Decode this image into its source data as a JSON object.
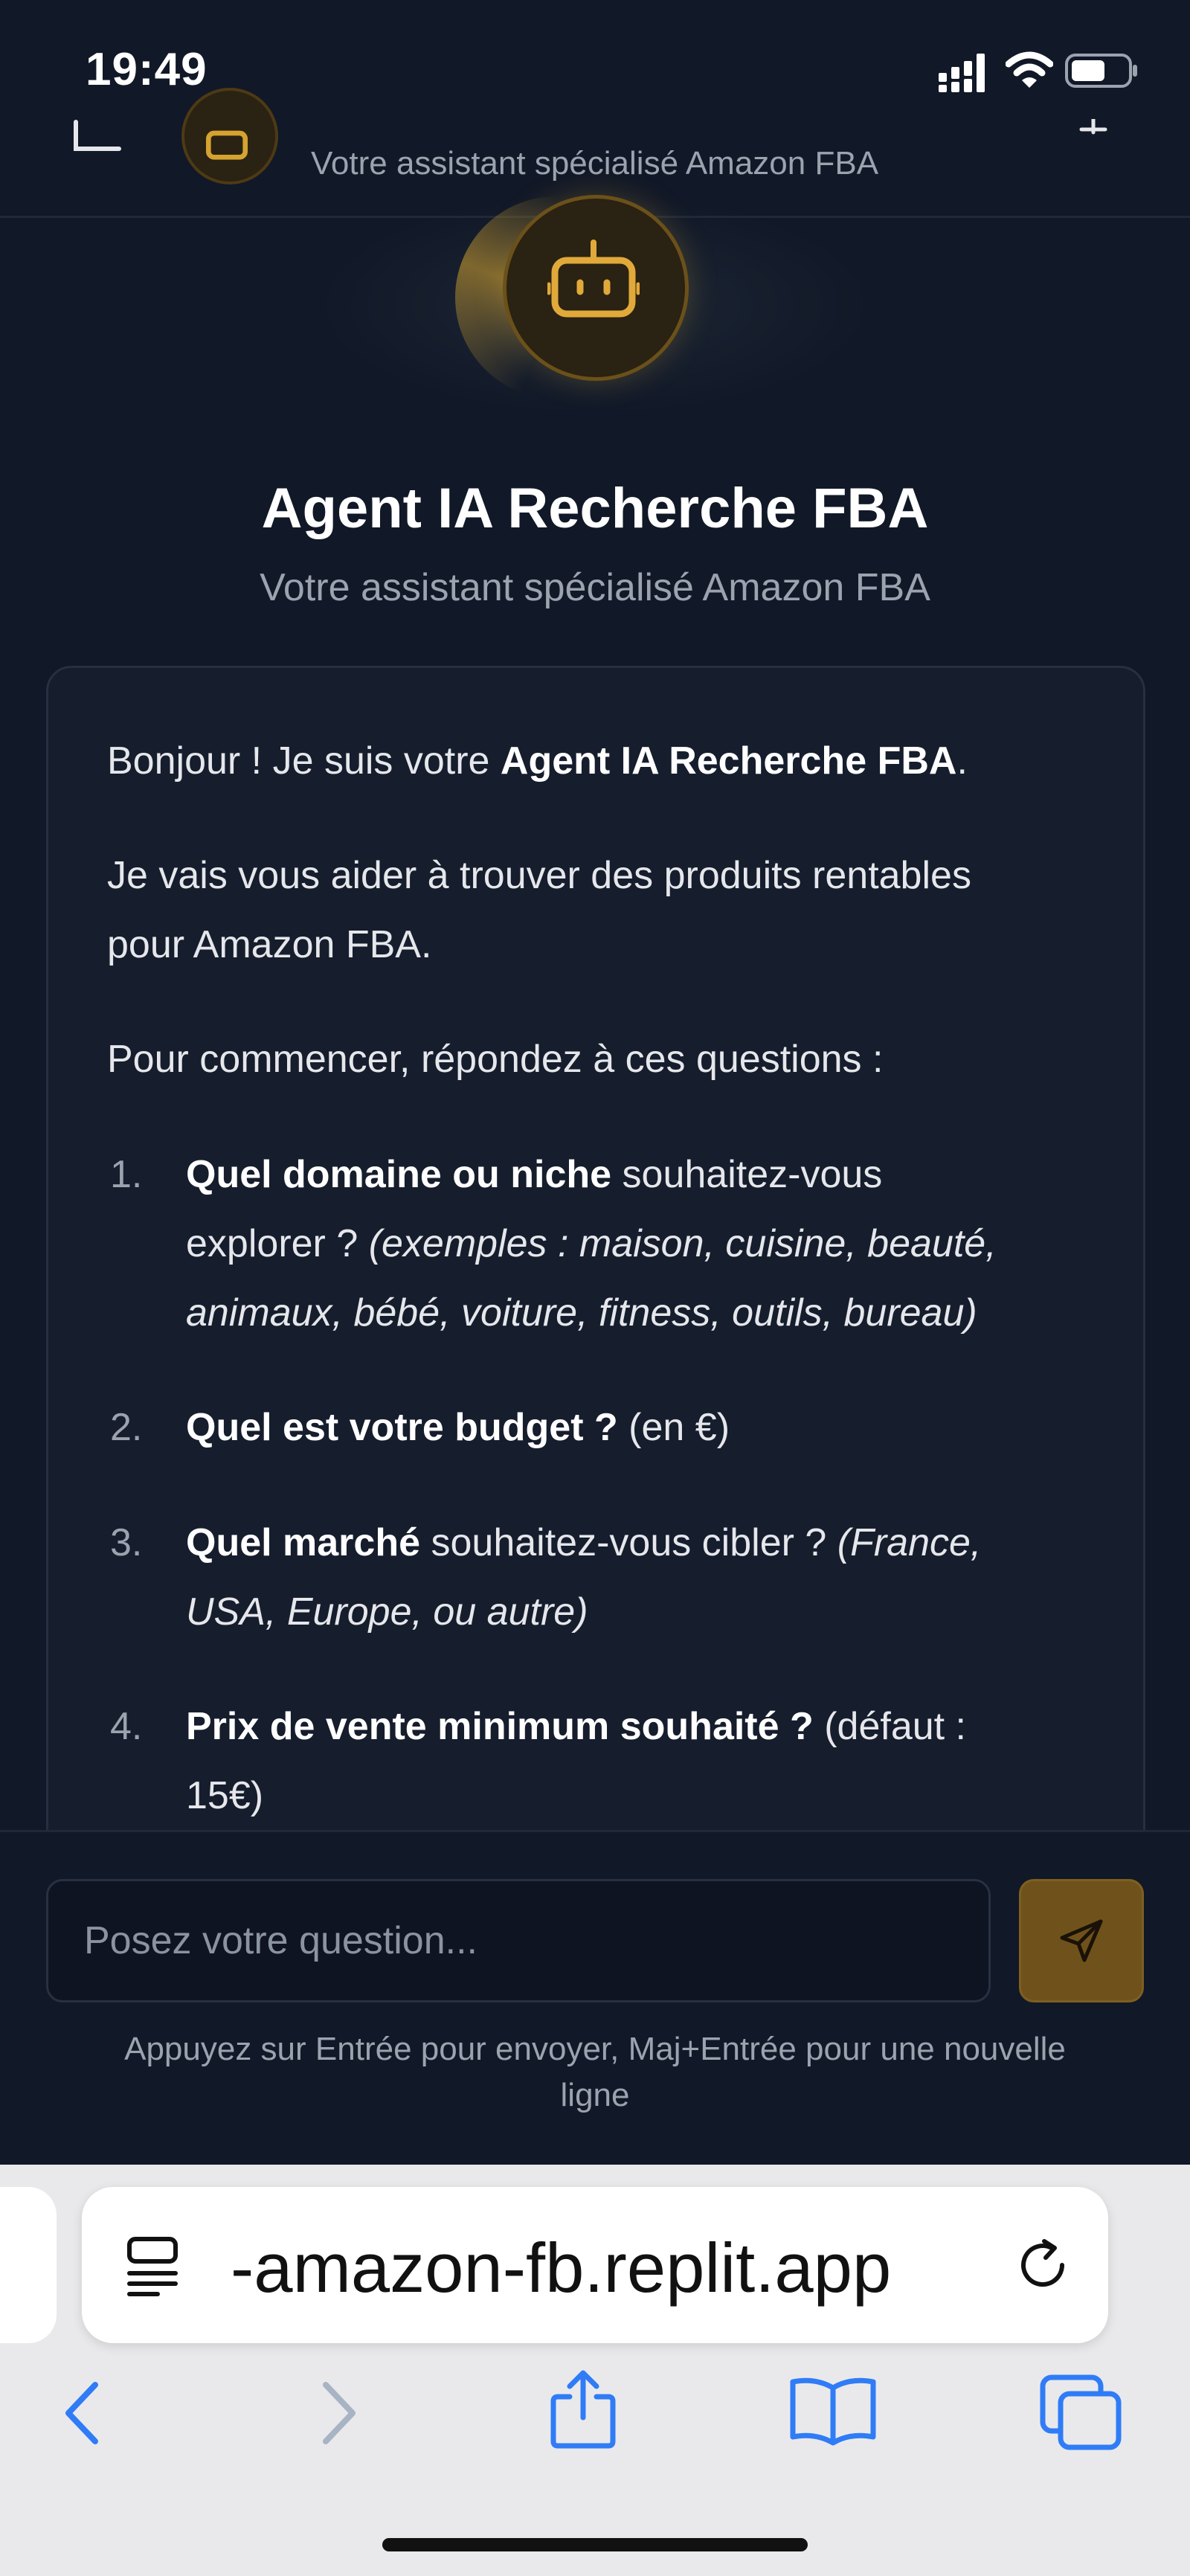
{
  "status_bar": {
    "time": "19:49"
  },
  "header": {
    "subtitle": "Votre assistant spécialisé Amazon FBA"
  },
  "hero": {
    "title": "Agent IA Recherche FBA",
    "subtitle": "Votre assistant spécialisé Amazon FBA"
  },
  "message": {
    "greeting_prefix": "Bonjour ! Je suis votre ",
    "greeting_bold": "Agent IA Recherche FBA",
    "greeting_suffix": ".",
    "intro_line1": "Je vais vous aider à trouver des produits rentables",
    "intro_line2": "pour Amazon FBA.",
    "prompt": "Pour commencer, répondez à ces questions :",
    "questions": [
      {
        "number": "1.",
        "bold": "Quel domaine ou niche",
        "text_line1": " souhaitez-vous",
        "text_line2": "explorer ? ",
        "italic_line2": "(exemples : maison, cuisine, beauté,",
        "italic_line3": "animaux, bébé, voiture, fitness, outils, bureau)"
      },
      {
        "number": "2.",
        "bold": "Quel est votre budget ?",
        "text_line1": " (en €)"
      },
      {
        "number": "3.",
        "bold": "Quel marché",
        "text_line1": " souhaitez-vous cibler ? ",
        "italic_line1": "(France,",
        "italic_line2": "USA, Europe, ou autre)"
      },
      {
        "number": "4.",
        "bold": "Prix de vente minimum souhaité ?",
        "text_line1": " (défaut :",
        "text_line2": "15€)"
      }
    ]
  },
  "composer": {
    "placeholder": "Posez votre question...",
    "hint_line1": "Appuyez sur Entrée pour envoyer, Maj+Entrée pour une nouvelle",
    "hint_line2": "ligne"
  },
  "browser": {
    "url": "-amazon-fb.replit.app"
  },
  "colors": {
    "accent": "#d4a330",
    "background": "#111827",
    "card": "#161d2d",
    "send_button": "#6f521b"
  }
}
